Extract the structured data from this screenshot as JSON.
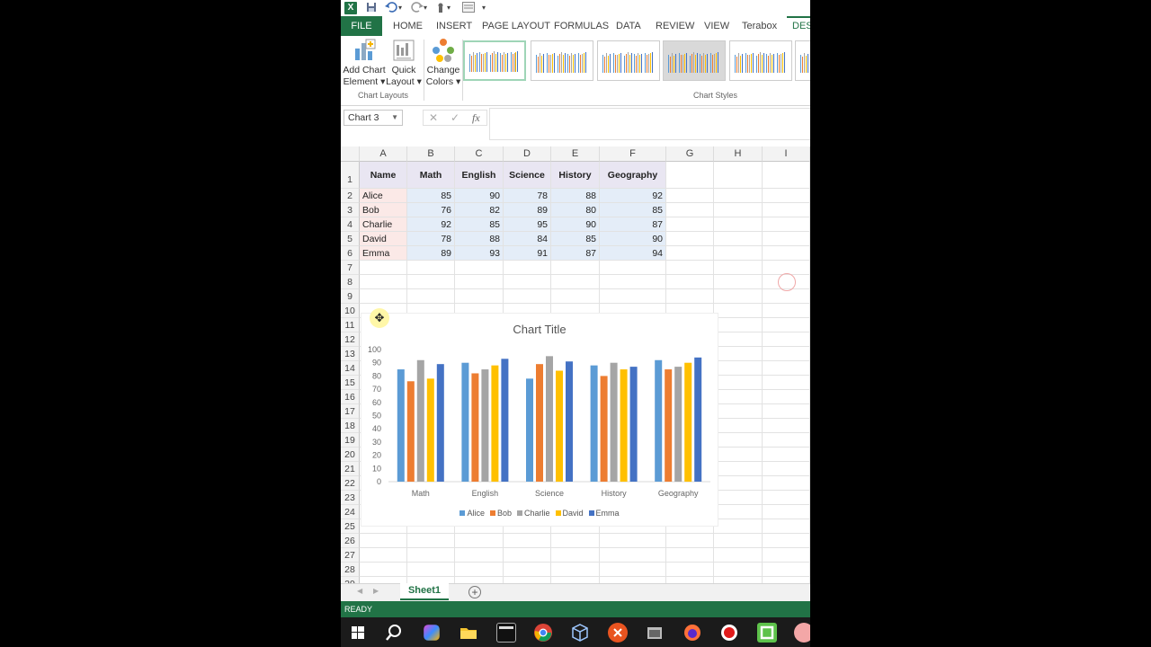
{
  "ribbon": {
    "tabs": [
      "FILE",
      "HOME",
      "INSERT",
      "PAGE LAYOUT",
      "FORMULAS",
      "DATA",
      "REVIEW",
      "VIEW",
      "Terabox",
      "DES"
    ],
    "buttons": {
      "add_chart_element": [
        "Add Chart",
        "Element ▾"
      ],
      "quick_layout": [
        "Quick",
        "Layout ▾"
      ],
      "change_colors": [
        "Change",
        "Colors ▾"
      ]
    },
    "groups": {
      "layouts": "Chart Layouts",
      "styles": "Chart Styles"
    }
  },
  "formula_bar": {
    "name_box": "Chart 3",
    "fx": "fx",
    "cancel": "✕",
    "enter": "✓"
  },
  "grid": {
    "columns": [
      "A",
      "B",
      "C",
      "D",
      "E",
      "F",
      "G",
      "H",
      "I"
    ],
    "rows": [
      "1",
      "2",
      "3",
      "4",
      "5",
      "6",
      "7",
      "8",
      "9",
      "10",
      "11",
      "12",
      "13",
      "14",
      "15",
      "16",
      "17",
      "18",
      "19",
      "20",
      "21",
      "22",
      "23",
      "24",
      "25",
      "26",
      "27",
      "28",
      "29"
    ],
    "header": [
      "Name",
      "Math",
      "English",
      "Science",
      "History",
      "Geography"
    ],
    "data": [
      [
        "Alice",
        "85",
        "90",
        "78",
        "88",
        "92"
      ],
      [
        "Bob",
        "76",
        "82",
        "89",
        "80",
        "85"
      ],
      [
        "Charlie",
        "92",
        "85",
        "95",
        "90",
        "87"
      ],
      [
        "David",
        "78",
        "88",
        "84",
        "85",
        "90"
      ],
      [
        "Emma",
        "89",
        "93",
        "91",
        "87",
        "94"
      ]
    ]
  },
  "chart_data": {
    "type": "bar",
    "title": "Chart Title",
    "categories": [
      "Math",
      "English",
      "Science",
      "History",
      "Geography"
    ],
    "series": [
      {
        "name": "Alice",
        "values": [
          85,
          90,
          78,
          88,
          92
        ],
        "color": "#5b9bd5"
      },
      {
        "name": "Bob",
        "values": [
          76,
          82,
          89,
          80,
          85
        ],
        "color": "#ed7d31"
      },
      {
        "name": "Charlie",
        "values": [
          92,
          85,
          95,
          90,
          87
        ],
        "color": "#a5a5a5"
      },
      {
        "name": "David",
        "values": [
          78,
          88,
          84,
          85,
          90
        ],
        "color": "#ffc000"
      },
      {
        "name": "Emma",
        "values": [
          89,
          93,
          91,
          87,
          94
        ],
        "color": "#4472c4"
      }
    ],
    "ylim": [
      0,
      100
    ],
    "yticks": [
      0,
      10,
      20,
      30,
      40,
      50,
      60,
      70,
      80,
      90,
      100
    ],
    "grid": false,
    "legend": "bottom"
  },
  "sheet_tab": "Sheet1",
  "status": "READY",
  "colors": {
    "excel_green": "#217346"
  },
  "icons": [
    "excel-icon",
    "save-icon",
    "undo-icon",
    "redo-icon",
    "touch-icon",
    "form-icon",
    "windows-start-icon",
    "search-icon",
    "folder-icon",
    "chrome-icon",
    "firefox-icon"
  ]
}
